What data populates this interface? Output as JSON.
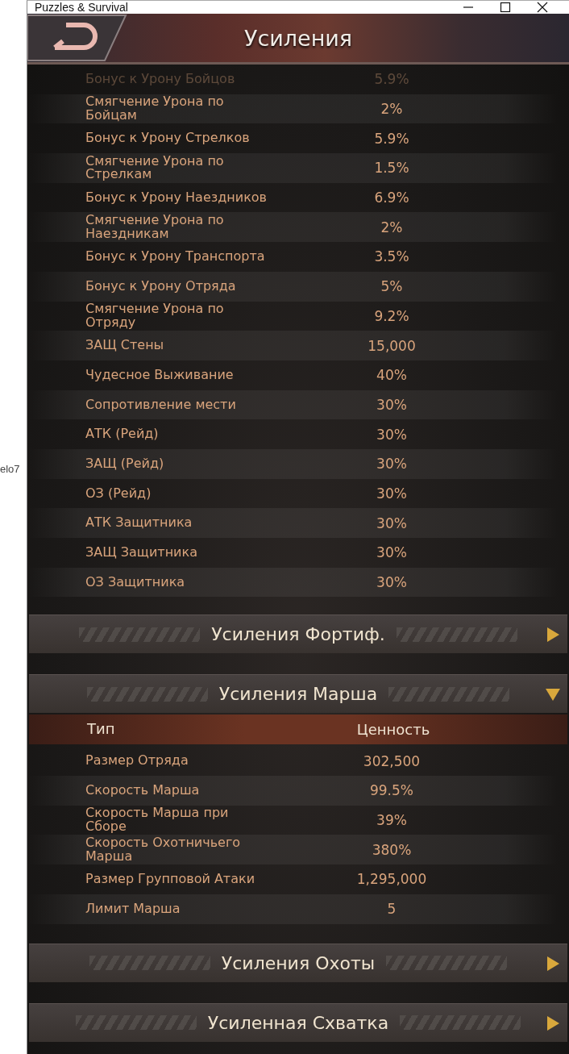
{
  "side_text": "elo7",
  "window": {
    "title": "Puzzles & Survival"
  },
  "header": {
    "title": "Усиления"
  },
  "top_table": {
    "rows": [
      {
        "label": "Бонус к Урону Бойцов",
        "value": "5.9%",
        "faded": true
      },
      {
        "label": "Смягчение Урона по Бойцам",
        "value": "2%",
        "faded": false
      },
      {
        "label": "Бонус к Урону Стрелков",
        "value": "5.9%",
        "faded": false
      },
      {
        "label": "Смягчение Урона по Стрелкам",
        "value": "1.5%",
        "faded": false
      },
      {
        "label": "Бонус к Урону Наездников",
        "value": "6.9%",
        "faded": false
      },
      {
        "label": "Смягчение Урона по Наездникам",
        "value": "2%",
        "faded": false
      },
      {
        "label": "Бонус к Урону Транспорта",
        "value": "3.5%",
        "faded": false
      },
      {
        "label": "Бонус к Урону Отряда",
        "value": "5%",
        "faded": false
      },
      {
        "label": "Смягчение Урона по Отряду",
        "value": "9.2%",
        "faded": false
      },
      {
        "label": "ЗАЩ Стены",
        "value": "15,000",
        "faded": false
      },
      {
        "label": "Чудесное Выживание",
        "value": "40%",
        "faded": false
      },
      {
        "label": "Сопротивление мести",
        "value": "30%",
        "faded": false
      },
      {
        "label": "АТК (Рейд)",
        "value": "30%",
        "faded": false
      },
      {
        "label": "ЗАЩ (Рейд)",
        "value": "30%",
        "faded": false
      },
      {
        "label": "ОЗ (Рейд)",
        "value": "30%",
        "faded": false
      },
      {
        "label": "АТК Защитника",
        "value": "30%",
        "faded": false
      },
      {
        "label": "ЗАЩ Защитника",
        "value": "30%",
        "faded": false
      },
      {
        "label": "ОЗ Защитника",
        "value": "30%",
        "faded": false
      }
    ]
  },
  "sections": [
    {
      "title": "Усиления Фортиф.",
      "expanded": false
    },
    {
      "title": "Усиления Марша",
      "expanded": true,
      "columns": [
        "Тип",
        "Ценность"
      ],
      "rows": [
        {
          "label": "Размер Отряда",
          "value": "302,500"
        },
        {
          "label": "Скорость Марша",
          "value": "99.5%"
        },
        {
          "label": "Скорость Марша при Сборе",
          "value": "39%"
        },
        {
          "label": "Скорость Охотничьего Марша",
          "value": "380%"
        },
        {
          "label": "Размер Групповой Атаки",
          "value": "1,295,000"
        },
        {
          "label": "Лимит Марша",
          "value": "5"
        }
      ]
    },
    {
      "title": "Усиления Охоты",
      "expanded": false
    },
    {
      "title": "Усиленная Схватка",
      "expanded": false
    }
  ]
}
